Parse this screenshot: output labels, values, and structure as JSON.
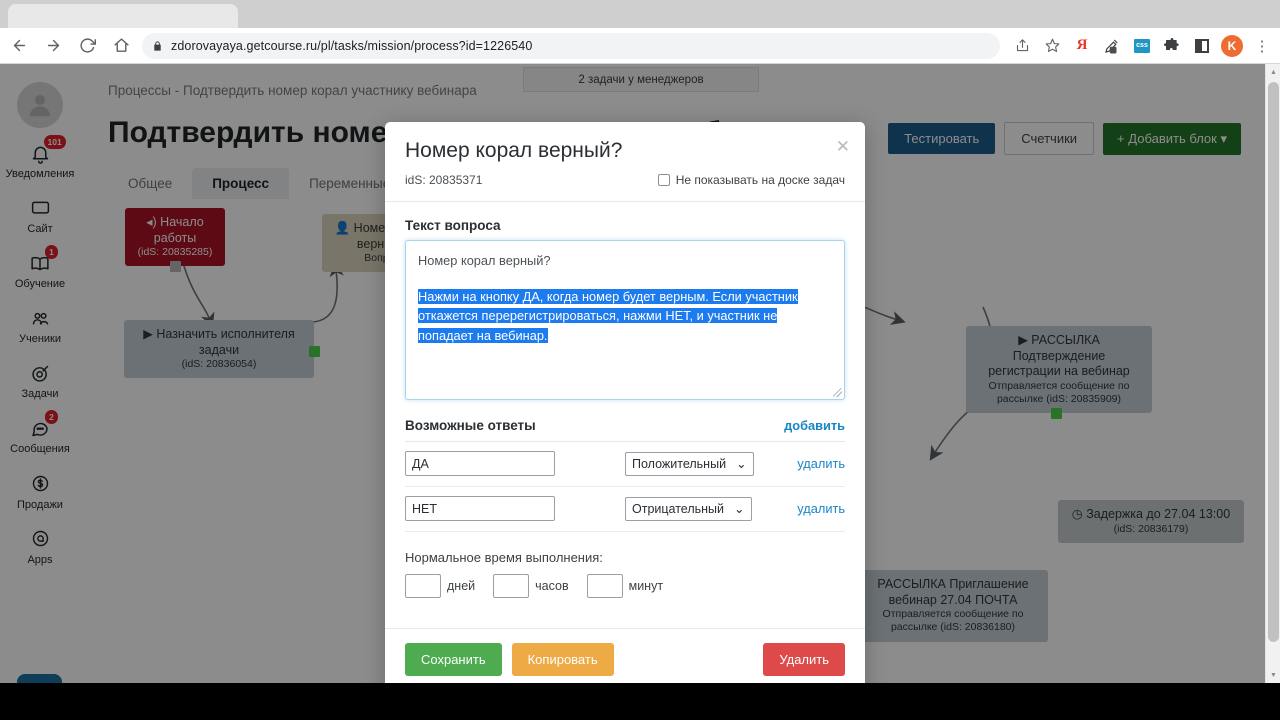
{
  "browser": {
    "url": "zdorovayaya.getcourse.ru/pl/tasks/mission/process?id=1226540",
    "back_icon": "back-arrow-icon",
    "forward_icon": "forward-arrow-icon",
    "reload_icon": "reload-icon",
    "home_icon": "home-icon",
    "lock_icon": "lock-icon",
    "share_icon": "share-icon",
    "bookmark_icon": "star-icon",
    "yandex_label": "Я",
    "extension_label": "css",
    "profile_initial": "K",
    "menu_icon": "kebab-menu-icon"
  },
  "rail": {
    "avatar": "user-avatar",
    "items": [
      {
        "label": "Уведомления",
        "badge": "101",
        "icon": "bell-icon"
      },
      {
        "label": "Сайт",
        "badge": "",
        "icon": "monitor-icon"
      },
      {
        "label": "Обучение",
        "badge": "1",
        "icon": "book-icon"
      },
      {
        "label": "Ученики",
        "badge": "",
        "icon": "people-icon"
      },
      {
        "label": "Задачи",
        "badge": "",
        "icon": "target-icon"
      },
      {
        "label": "Сообщения",
        "badge": "2",
        "icon": "chat-icon"
      },
      {
        "label": "Продажи",
        "badge": "",
        "icon": "dollar-icon"
      },
      {
        "label": "Apps",
        "badge": "",
        "icon": "apps-icon"
      }
    ],
    "telegram_icon": "telegram-send-icon"
  },
  "page": {
    "breadcrumb": "Процессы - Подтвердить номер корал участнику вебинара",
    "title": "Подтвердить номер корал участнику вебинаром",
    "toast": "2 задачи у менеджеров",
    "tabs": [
      {
        "label": "Общее",
        "active": false
      },
      {
        "label": "Процесс",
        "active": true
      },
      {
        "label": "Переменные",
        "active": false
      }
    ],
    "actions": {
      "test": "Тестировать",
      "counters": "Счетчики",
      "add_block": "Добавить блок",
      "add_block_plus": "+",
      "add_block_caret": "▾"
    }
  },
  "flow": {
    "nodes": [
      {
        "title": "Начало работы",
        "sub": "(idS: 20835285)",
        "marker": "◂)"
      },
      {
        "title": "Назначить исполнителя задачи",
        "sub": "(idS: 20836054)",
        "marker": "▶"
      },
      {
        "title": "Номер корал верный?",
        "sub": "Вопрос",
        "marker": "👤"
      },
      {
        "title_l1": "РАССЫЛКА",
        "title_l2": "Подтверждение",
        "title_l3": "регистрации на вебинар",
        "sub_l1": "Отправляется сообщение по",
        "sub_l2": "рассылке (idS: 20835909)",
        "marker": "▶"
      },
      {
        "title": "Задержка до 27.04 13:00",
        "sub": "(idS: 20836179)",
        "marker": "◷"
      },
      {
        "title_l1": "РАССЫЛКА Приглашение",
        "title_l2": "вебинар 27.04 ПОЧТА",
        "sub_l1": "Отправляется сообщение по",
        "sub_l2": "рассылке (idS: 20836180)"
      }
    ]
  },
  "modal": {
    "title": "Номер корал верный?",
    "close_icon": "close-icon",
    "ids": "idS: 20835371",
    "hide_checkbox_label": "Не показывать на доске задач",
    "hide_checkbox_checked": false,
    "question_label": "Текст вопроса",
    "question_line1": "Номер корал верный?",
    "question_selected": "Нажми на кнопку ДА, когда номер будет верным. Если участник откажется перерегистрироваться, нажми НЕТ, и участник не попадает на вебинар.",
    "answers_title": "Возможные ответы",
    "add_link": "добавить",
    "answers": [
      {
        "value": "ДА",
        "type": "Положительный",
        "delete": "удалить"
      },
      {
        "value": "НЕТ",
        "type": "Отрицательный",
        "delete": "удалить"
      }
    ],
    "time_label": "Нормальное время выполнения:",
    "time": {
      "days_value": "",
      "days_unit": "дней",
      "hours_value": "",
      "hours_unit": "часов",
      "minutes_value": "",
      "minutes_unit": "минут"
    },
    "footer": {
      "save": "Сохранить",
      "copy": "Копировать",
      "delete": "Удалить"
    }
  },
  "colors": {
    "accent_blue": "#1d7bf0",
    "save_green": "#4eab50",
    "copy_orange": "#eeab45",
    "delete_red": "#de4a4a",
    "start_node_red": "#a91327",
    "link_blue": "#1886c9"
  }
}
